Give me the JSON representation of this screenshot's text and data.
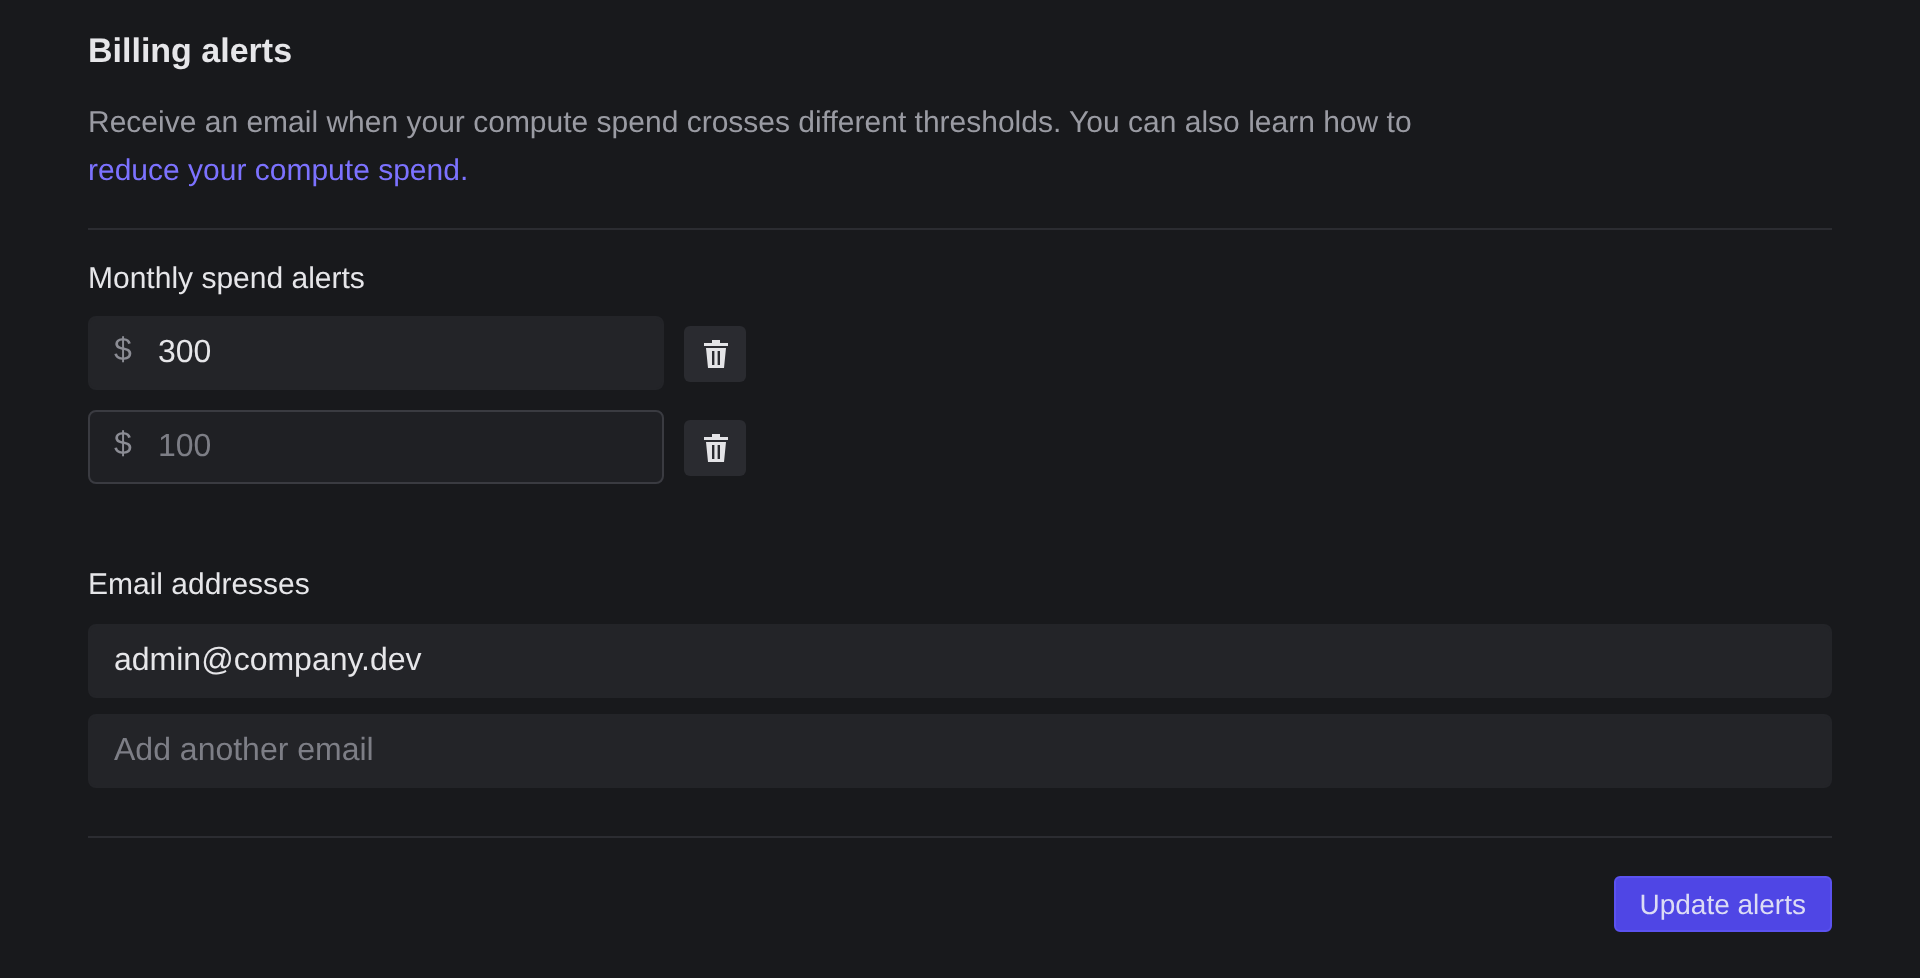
{
  "title": "Billing alerts",
  "description": {
    "text": "Receive an email when your compute spend crosses different thresholds. You can also learn how to ",
    "link": "reduce your compute spend."
  },
  "monthly_spend_alerts": {
    "label": "Monthly spend alerts",
    "items": [
      {
        "prefix": "$",
        "value": "300",
        "focused": false
      },
      {
        "prefix": "$",
        "placeholder": "100",
        "focused": true
      }
    ]
  },
  "email_addresses": {
    "label": "Email addresses",
    "items": [
      {
        "value": "admin@company.dev"
      },
      {
        "placeholder": "Add another email"
      }
    ]
  },
  "button": "Update alerts"
}
